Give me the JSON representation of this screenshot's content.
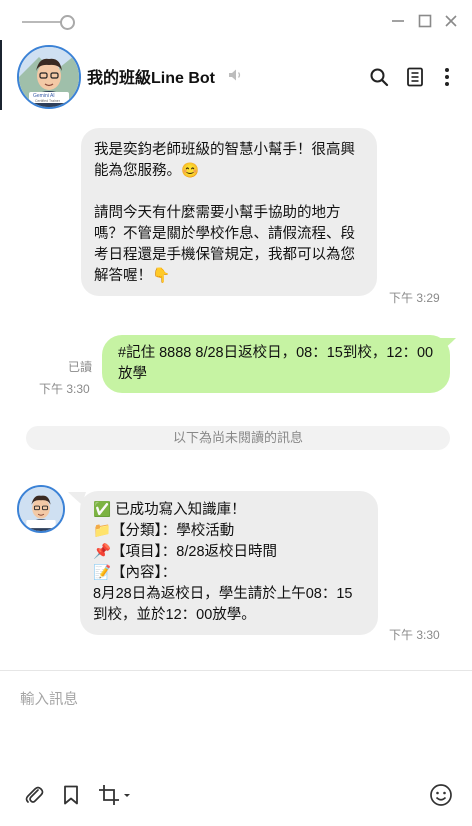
{
  "header": {
    "title": "我的班級Line Bot",
    "avatar_badge": "Gemini AI",
    "avatar_badge_sub": "Certified Trainer",
    "icons": [
      "slider-icon",
      "minimize-icon",
      "maximize-icon",
      "close-icon",
      "mute-icon",
      "search-icon",
      "notes-icon",
      "more-icon"
    ]
  },
  "messages": [
    {
      "from": "bot",
      "text": "我是奕鈞老師班級的智慧小幫手！很高興能為您服務。😊\n\n請問今天有什麼需要小幫手協助的地方嗎？不管是關於學校作息、請假流程、段考日程還是手機保管規定，我都可以為您解答喔！👇",
      "time": "下午 3:29"
    },
    {
      "from": "me",
      "text": "#記住 8888 8/28日返校日，08：15到校，12：00放學",
      "read": "已讀",
      "time": "下午 3:30"
    },
    {
      "from": "bot",
      "text": "✅ 已成功寫入知識庫！\n📁【分類】：學校活動\n📌【項目】：8/28返校日時間\n📝【內容】：\n8月28日為返校日，學生請於上午08：15到校，並於12：00放學。",
      "time": "下午 3:30"
    }
  ],
  "unread_divider": "以下為尚未閱讀的訊息",
  "input": {
    "placeholder": "輸入訊息"
  },
  "toolbar": {
    "icons": [
      "paperclip-icon",
      "bookmark-icon",
      "crop-icon",
      "emoji-icon"
    ]
  },
  "colors": {
    "incoming_bubble": "#ededed",
    "outgoing_bubble": "#c6f3a3",
    "avatar_ring": "#3b82d6"
  }
}
